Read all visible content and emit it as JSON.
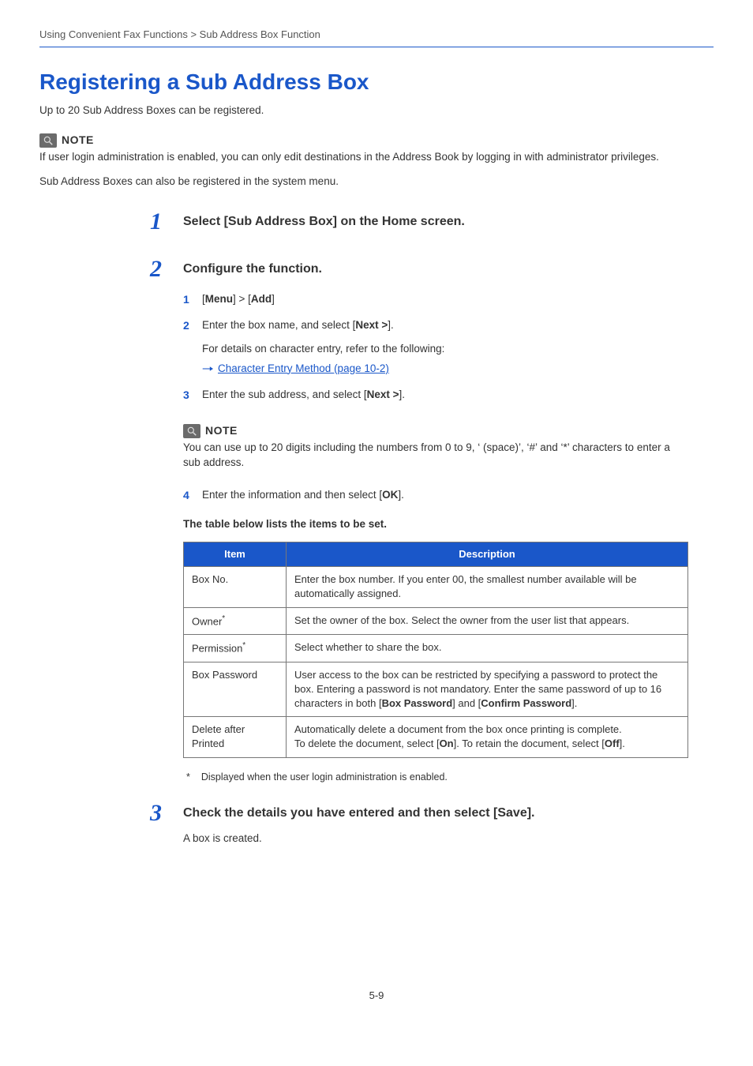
{
  "breadcrumb": "Using Convenient Fax Functions > Sub Address Box Function",
  "title": "Registering a Sub Address Box",
  "intro": "Up to 20 Sub Address Boxes can be registered.",
  "note1": {
    "label": "NOTE",
    "body1": "If user login administration is enabled, you can only edit destinations in the Address Book by logging in with administrator privileges.",
    "body2": "Sub Address Boxes can also be registered in the system menu."
  },
  "step1": {
    "num": "1",
    "title": "Select [Sub Address Box] on the Home screen."
  },
  "step2": {
    "num": "2",
    "title": "Configure the function.",
    "subs": {
      "s1num": "1",
      "s1a": "[",
      "s1b": "Menu",
      "s1c": "] > [",
      "s1d": "Add",
      "s1e": "]",
      "s2num": "2",
      "s2a": "Enter the box name, and select [",
      "s2b": "Next >",
      "s2c": "].",
      "s2d": "For details on character entry, refer to the following:",
      "s2link": "Character Entry Method (page 10-2)",
      "s3num": "3",
      "s3a": "Enter the sub address, and select [",
      "s3b": "Next >",
      "s3c": "].",
      "note_label": "NOTE",
      "note_body": "You can use up to 20 digits including the numbers from 0 to 9, ‘ (space)’, ‘#’ and ‘*’ characters to enter a sub address.",
      "s4num": "4",
      "s4a": "Enter the information and then select [",
      "s4b": "OK",
      "s4c": "].",
      "caption": "The table below lists the items to be set."
    }
  },
  "table": {
    "h1": "Item",
    "h2": "Description",
    "rows": [
      {
        "item": "Box No.",
        "sup": "",
        "desc": "Enter the box number. If you enter 00, the smallest number available will be automatically assigned."
      },
      {
        "item": "Owner",
        "sup": "*",
        "desc": "Set the owner of the box. Select the owner from the user list that appears."
      },
      {
        "item": "Permission",
        "sup": "*",
        "desc": "Select whether to share the box."
      },
      {
        "item": "Box Password",
        "sup": "",
        "desc_pre": "User access to the box can be restricted by specifying a password to protect the box. Entering a password is not mandatory. Enter the same password of up to 16 characters in both [",
        "desc_b1": "Box Password",
        "desc_mid": "] and [",
        "desc_b2": "Confirm Password",
        "desc_post": "]."
      },
      {
        "item": "Delete after Printed",
        "sup": "",
        "desc_pre": "Automatically delete a document from the box once printing is complete.\nTo delete the document, select [",
        "desc_b1": "On",
        "desc_mid": "]. To retain the document, select [",
        "desc_b2": "Off",
        "desc_post": "]."
      }
    ],
    "footnote_star": "*",
    "footnote": "Displayed when the user login administration is enabled."
  },
  "step3": {
    "num": "3",
    "title": "Check the details you have entered and then select [Save].",
    "body": "A box is created."
  },
  "page_num": "5-9"
}
